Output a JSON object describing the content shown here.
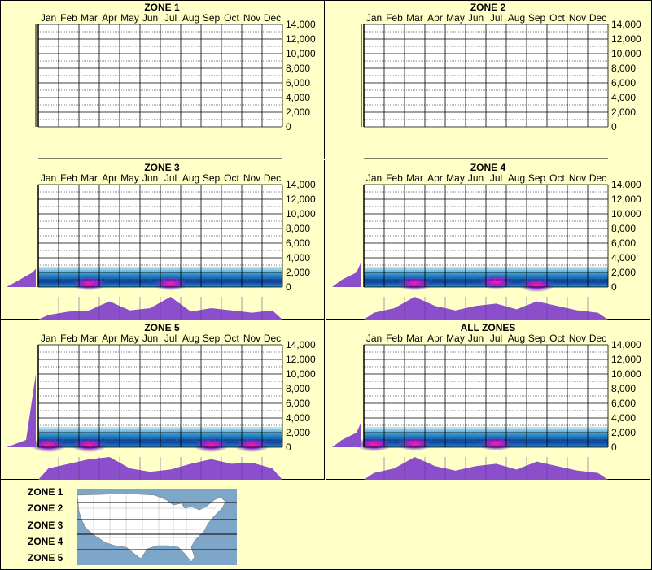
{
  "months": [
    "Jan",
    "Feb",
    "Mar",
    "Apr",
    "May",
    "Jun",
    "Jul",
    "Aug",
    "Sep",
    "Oct",
    "Nov",
    "Dec"
  ],
  "y_ticks": [
    "14,000",
    "12,000",
    "10,000",
    "8,000",
    "6,000",
    "4,000",
    "2,000",
    "0"
  ],
  "colors": {
    "background": "#ffffc8",
    "profile": "#8c4fcc",
    "heat_low": "#2a8fc6",
    "heat_high": "#ff1c9e",
    "map_water": "#7ea6c8",
    "map_land": "#ffffff"
  },
  "chart_data": [
    {
      "type": "heatmap",
      "title": "ZONE 1",
      "ylim": [
        0,
        14000
      ],
      "has_data": false
    },
    {
      "type": "heatmap",
      "title": "ZONE 2",
      "ylim": [
        0,
        14000
      ],
      "has_data": false
    },
    {
      "type": "heatmap",
      "title": "ZONE 3",
      "ylim": [
        0,
        14000
      ],
      "has_data": true,
      "monthly_profile": [
        0.2,
        0.35,
        0.4,
        0.8,
        0.4,
        0.5,
        1.0,
        0.35,
        0.5,
        0.4,
        0.3,
        0.4
      ],
      "elevation_profile": [
        [
          0,
          0.1
        ],
        [
          1000,
          0.5
        ],
        [
          2000,
          0.9
        ],
        [
          2500,
          1.0
        ]
      ],
      "hotspots": [
        {
          "month": "Mar",
          "elevation": 500
        },
        {
          "month": "Jul",
          "elevation": 500
        }
      ]
    },
    {
      "type": "heatmap",
      "title": "ZONE 4",
      "ylim": [
        0,
        14000
      ],
      "has_data": true,
      "monthly_profile": [
        0.3,
        0.5,
        1.0,
        0.6,
        0.4,
        0.6,
        0.7,
        0.45,
        0.8,
        0.6,
        0.4,
        0.3
      ],
      "elevation_profile": [
        [
          0,
          0.1
        ],
        [
          1000,
          0.4
        ],
        [
          2000,
          0.85
        ],
        [
          3500,
          1.0
        ]
      ],
      "hotspots": [
        {
          "month": "Mar",
          "elevation": 500
        },
        {
          "month": "Jul",
          "elevation": 700
        },
        {
          "month": "Sep",
          "elevation": 300
        }
      ]
    },
    {
      "type": "heatmap",
      "title": "ZONE 5",
      "ylim": [
        0,
        14000
      ],
      "has_data": true,
      "monthly_profile": [
        0.5,
        0.7,
        0.9,
        1.0,
        0.5,
        0.35,
        0.45,
        0.7,
        0.9,
        0.7,
        0.75,
        0.5
      ],
      "elevation_profile": [
        [
          0,
          0.1
        ],
        [
          500,
          0.4
        ],
        [
          1000,
          0.7
        ],
        [
          10000,
          1.0
        ]
      ],
      "hotspots": [
        {
          "month": "Jan",
          "elevation": 300
        },
        {
          "month": "Mar",
          "elevation": 300
        },
        {
          "month": "Sep",
          "elevation": 300
        },
        {
          "month": "Nov",
          "elevation": 300
        }
      ]
    },
    {
      "type": "heatmap",
      "title": "ALL ZONES",
      "ylim": [
        0,
        14000
      ],
      "has_data": true,
      "monthly_profile": [
        0.3,
        0.5,
        1.0,
        0.6,
        0.4,
        0.6,
        0.7,
        0.45,
        0.8,
        0.6,
        0.4,
        0.3
      ],
      "elevation_profile": [
        [
          0,
          0.1
        ],
        [
          1000,
          0.4
        ],
        [
          2000,
          0.85
        ],
        [
          3500,
          1.0
        ]
      ],
      "hotspots": [
        {
          "month": "Jan",
          "elevation": 400
        },
        {
          "month": "Mar",
          "elevation": 500
        },
        {
          "month": "Jul",
          "elevation": 500
        }
      ]
    }
  ],
  "legend": {
    "zones": [
      "ZONE 1",
      "ZONE 2",
      "ZONE 3",
      "ZONE 4",
      "ZONE 5"
    ]
  }
}
